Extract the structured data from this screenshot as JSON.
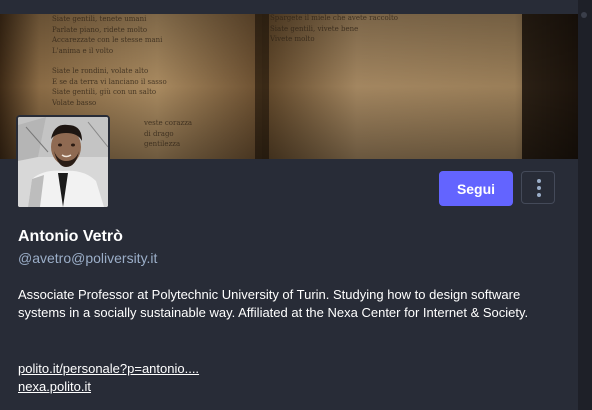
{
  "profile": {
    "display_name": "Antonio Vetrò",
    "handle": "@avetro@poliversity.it",
    "bio": "Associate Professor at Polytechnic University of Turin. Studying how to design software systems in a socially sustainable way. Affiliated at the Nexa Center for Internet & Society.",
    "links": [
      {
        "label": "polito.it/personale?p=antonio...."
      },
      {
        "label": "nexa.polito.it"
      }
    ]
  },
  "actions": {
    "follow_label": "Segui",
    "menu_icon": "vertical-ellipsis-icon"
  },
  "header_image": {
    "left_page_lines": [
      "Siate gentili, tenete umani",
      "Parlate piano, ridete molto",
      "Accarezzate con le stesse mani",
      "L'anima e il volto",
      "",
      "Siate le rondini, volate alto",
      "E se da terra vi lanciano il sasso",
      "Siate gentili, giù con un salto",
      "Volate basso",
      "",
      "veste corazza",
      "di drago",
      "gentilezza"
    ],
    "right_page_lines": [
      "Spargete il miele che avete raccolto",
      "Siate gentili, vivete bene",
      "Vivete molto"
    ]
  },
  "colors": {
    "background": "#282c37",
    "accent": "#6364ff",
    "muted_text": "#9baec8",
    "text": "#ffffff"
  }
}
